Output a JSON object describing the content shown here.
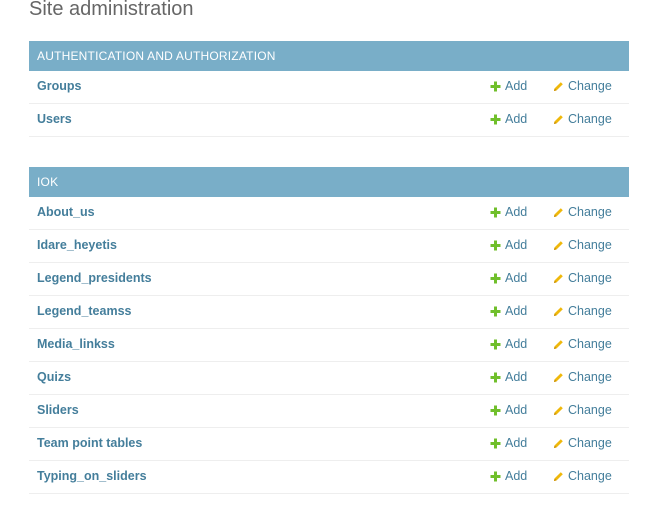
{
  "page": {
    "title": "Site administration"
  },
  "colors": {
    "caption_bg": "#79aec8",
    "link": "#447e9b",
    "add_icon": "#70bf2b",
    "change_icon": "#efb80b"
  },
  "icons": {
    "add": "plus-icon",
    "change": "pencil-icon"
  },
  "auth_module": {
    "caption": "AUTHENTICATION AND AUTHORIZATION",
    "rows": [
      {
        "name": "Groups",
        "add": "Add",
        "change": "Change"
      },
      {
        "name": "Users",
        "add": "Add",
        "change": "Change"
      }
    ]
  },
  "iok_module": {
    "caption": "IOK",
    "rows": [
      {
        "name": "About_us",
        "add": "Add",
        "change": "Change"
      },
      {
        "name": "Idare_heyetis",
        "add": "Add",
        "change": "Change"
      },
      {
        "name": "Legend_presidents",
        "add": "Add",
        "change": "Change"
      },
      {
        "name": "Legend_teamss",
        "add": "Add",
        "change": "Change"
      },
      {
        "name": "Media_linkss",
        "add": "Add",
        "change": "Change"
      },
      {
        "name": "Quizs",
        "add": "Add",
        "change": "Change"
      },
      {
        "name": "Sliders",
        "add": "Add",
        "change": "Change"
      },
      {
        "name": "Team point tables",
        "add": "Add",
        "change": "Change"
      },
      {
        "name": "Typing_on_sliders",
        "add": "Add",
        "change": "Change"
      }
    ]
  }
}
